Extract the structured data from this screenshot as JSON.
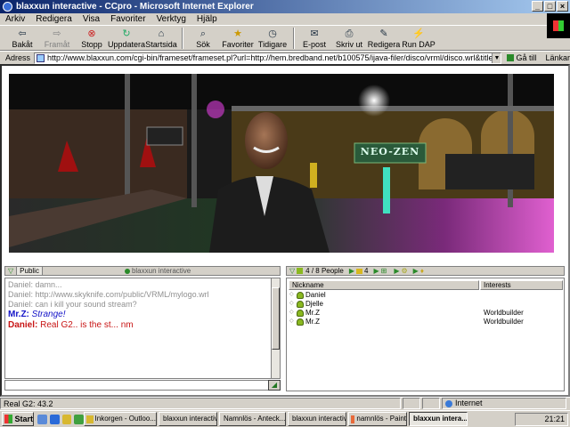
{
  "window": {
    "title": "blaxxun interactive - CCpro - Microsoft Internet Explorer",
    "controls": [
      "_",
      "□",
      "×"
    ]
  },
  "menu": [
    "Arkiv",
    "Redigera",
    "Visa",
    "Favoriter",
    "Verktyg",
    "Hjälp"
  ],
  "toolbar": {
    "buttons": [
      {
        "label": "Bakåt",
        "icon": "back-arrow-icon"
      },
      {
        "label": "Framåt",
        "icon": "forward-arrow-icon"
      },
      {
        "label": "Stopp",
        "icon": "stop-icon"
      },
      {
        "label": "Uppdatera",
        "icon": "refresh-icon"
      },
      {
        "label": "Startsida",
        "icon": "home-icon"
      },
      {
        "label": "Sök",
        "icon": "search-icon"
      },
      {
        "label": "Favoriter",
        "icon": "favorites-icon"
      },
      {
        "label": "Tidigare",
        "icon": "history-icon"
      },
      {
        "label": "E-post",
        "icon": "mail-icon"
      },
      {
        "label": "Skriv ut",
        "icon": "print-icon"
      },
      {
        "label": "Redigera",
        "icon": "edit-icon"
      },
      {
        "label": "Run DAP",
        "icon": "run-dap-icon"
      }
    ]
  },
  "address": {
    "label": "Adress",
    "url": "http://www.blaxxun.com/cgi-bin/frameset/frameset.pl?url=http://hem.bredband.net/b100575/ijava-filer/disco/vrml/disco.wrl&title=NeoZen",
    "go_label": "Gå till",
    "links_label": "Länkar"
  },
  "scene": {
    "sign_text": "NEO-ZEN",
    "colors": {
      "floor": "#1a3a1a",
      "accent_pink": "#e040e0",
      "accent_green": "#30c030"
    }
  },
  "chat": {
    "header_label": "Public",
    "brand_label": "blaxxun interactive",
    "lines": [
      {
        "user": "Daniel:",
        "text": "damn..."
      },
      {
        "user": "Daniel:",
        "text": "http://www.skyknife.com/public/VRML/mylogo.wrl"
      },
      {
        "user": "Daniel:",
        "text": "can i kill your sound stream?"
      },
      {
        "user": "Mr.Z:",
        "text": "Strange!"
      },
      {
        "user": "Daniel:",
        "text": "Real G2.. is the st... nm"
      }
    ]
  },
  "people": {
    "count_label": "4 / 8 People",
    "tab_count": "4",
    "columns": [
      "Nickname",
      "Interests"
    ],
    "rows": [
      {
        "nickname": "Daniel",
        "interests": ""
      },
      {
        "nickname": "Djelle",
        "interests": ""
      },
      {
        "nickname": "Mr.Z",
        "interests": "Worldbuilder"
      },
      {
        "nickname": "Mr.Z",
        "interests": "Worldbuilder"
      }
    ]
  },
  "status": {
    "text": "Real G2: 43.2",
    "zone": "Internet"
  },
  "taskbar": {
    "start_label": "Start",
    "tasks": [
      {
        "label": "Inkorgen - Outloo..."
      },
      {
        "label": "blaxxun interactiv..."
      },
      {
        "label": "Namnlös - Anteck..."
      },
      {
        "label": "blaxxun interactiv..."
      },
      {
        "label": "namnlös - Paint"
      },
      {
        "label": "blaxxun intera..."
      }
    ],
    "clock": "21:21"
  }
}
